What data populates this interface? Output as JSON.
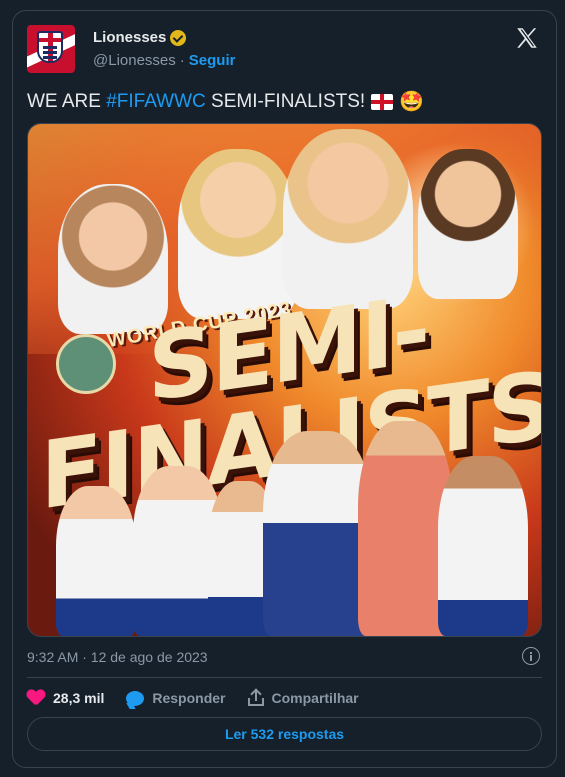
{
  "tweet": {
    "author_name": "Lionesses",
    "handle": "@Lionesses",
    "separator": "·",
    "follow_label": "Seguir",
    "text_prefix": "WE ARE ",
    "hashtag": "#FIFAWWC",
    "text_suffix": " SEMI-FINALISTS!",
    "emoji_star": "🤩",
    "timestamp": "9:32 AM · 12 de ago de 2023"
  },
  "media": {
    "headline_line1": "SEMI-",
    "headline_line2": "FINALISTS",
    "ribbon_text": "WORLD CUP 2023"
  },
  "actions": {
    "like_count": "28,3 mil",
    "reply_label": "Responder",
    "share_label": "Compartilhar"
  },
  "read_replies_label": "Ler 532 respostas",
  "colors": {
    "background": "#15202b",
    "accent": "#1d9bf0",
    "like": "#f91880",
    "verified": "#e2b719",
    "muted": "#8b98a5"
  },
  "icons": [
    "verified-badge-icon",
    "x-logo-icon",
    "england-flag-icon",
    "star-struck-emoji-icon",
    "info-icon",
    "heart-icon",
    "reply-bubble-icon",
    "share-icon"
  ]
}
